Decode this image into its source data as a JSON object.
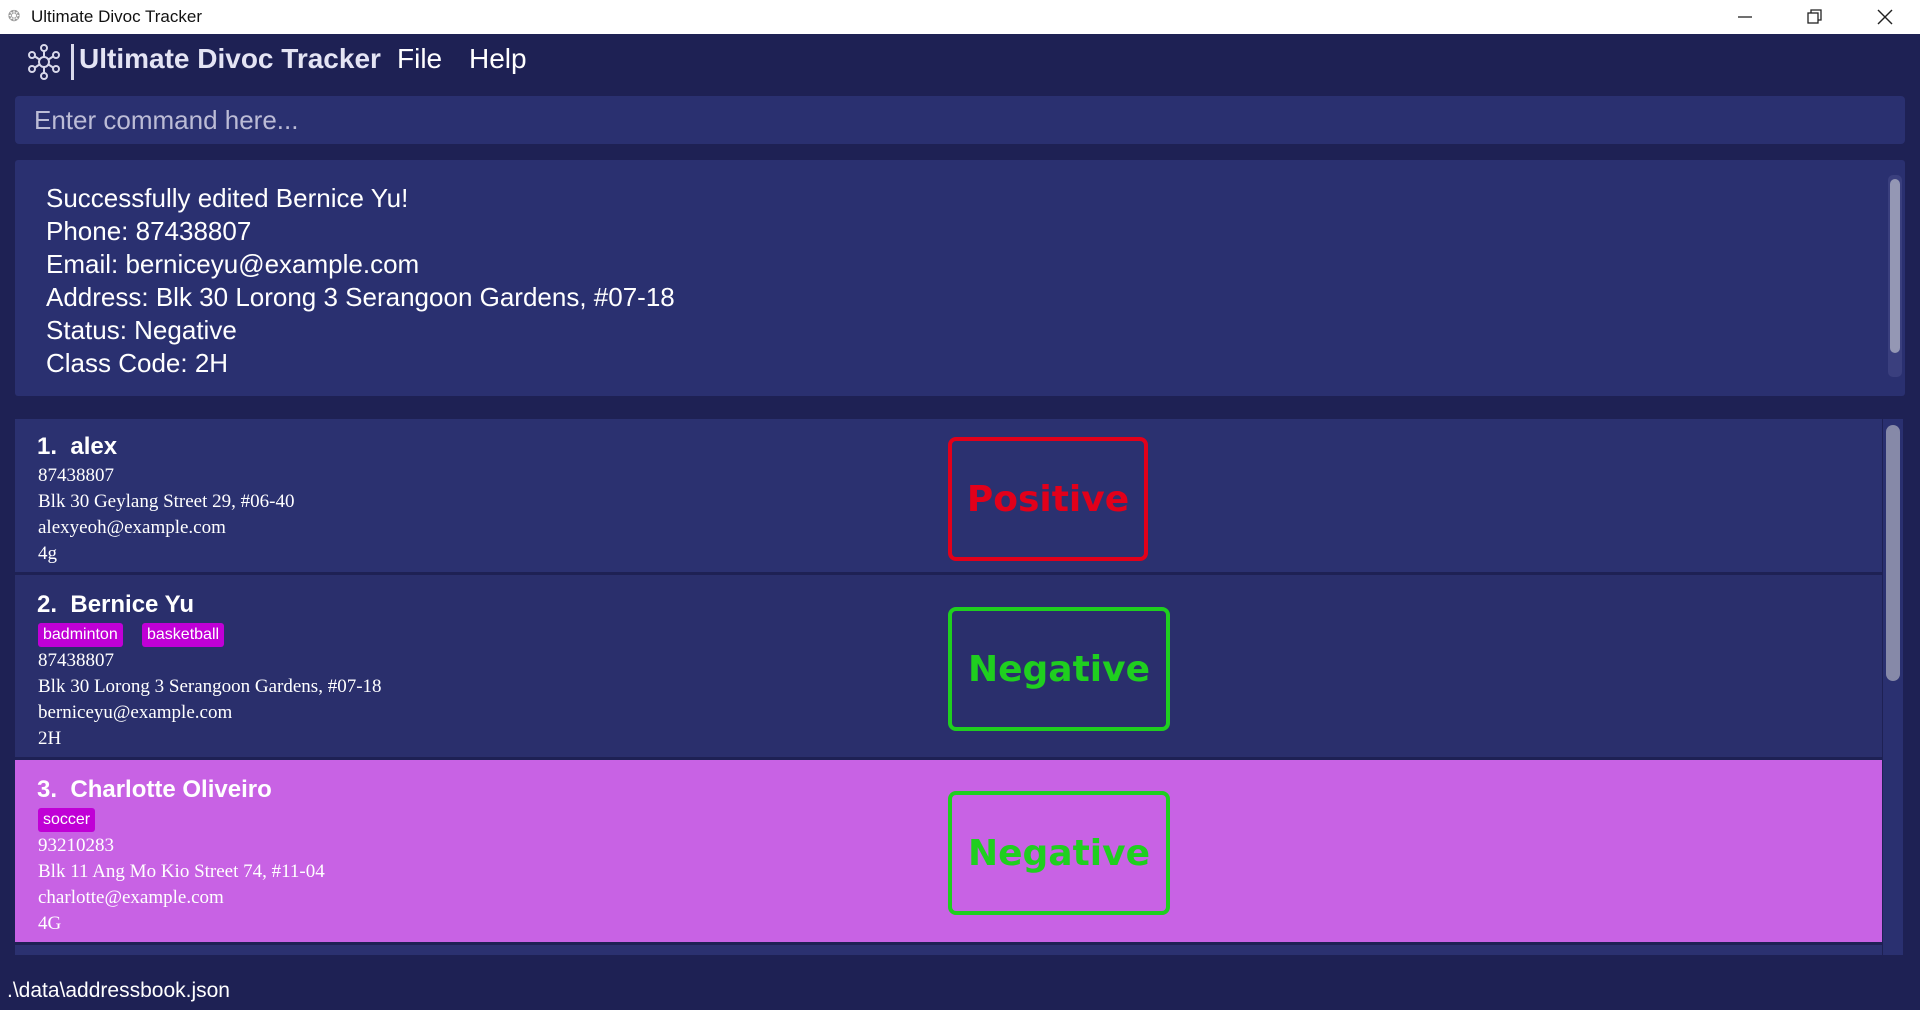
{
  "window": {
    "title": "Ultimate Divoc Tracker",
    "icon": "app-icon",
    "controls": [
      "minimize-icon",
      "restore-icon",
      "close-icon"
    ]
  },
  "menubar": {
    "brand": "Ultimate Divoc Tracker",
    "logo_icon": "gear-network-logo",
    "menus": [
      "File",
      "Help"
    ]
  },
  "command": {
    "placeholder": "Enter command here...",
    "value": ""
  },
  "result": {
    "text": "Successfully edited Bernice Yu!\nPhone: 87438807\nEmail: berniceyu@example.com\nAddress: Blk 30 Lorong 3 Serangoon Gardens, #07-18\nStatus: Negative\nClass Code: 2H"
  },
  "persons": [
    {
      "index": "1.",
      "name": "alex",
      "tags": [],
      "phone": "87438807",
      "address": "Blk 30 Geylang Street 29, #06-40",
      "email": "alexyeoh@example.com",
      "class_code": "4g",
      "status": "Positive",
      "status_color": "#e2001a",
      "selected": false
    },
    {
      "index": "2.",
      "name": "Bernice Yu",
      "tags": [
        "badminton",
        "basketball"
      ],
      "phone": "87438807",
      "address": "Blk 30 Lorong 3 Serangoon Gardens, #07-18",
      "email": "berniceyu@example.com",
      "class_code": "2H",
      "status": "Negative",
      "status_color": "#1fcf1f",
      "selected": false
    },
    {
      "index": "3.",
      "name": "Charlotte Oliveiro",
      "tags": [
        "soccer"
      ],
      "phone": "93210283",
      "address": "Blk 11 Ang Mo Kio Street 74, #11-04",
      "email": "charlotte@example.com",
      "class_code": "4G",
      "status": "Negative",
      "status_color": "#1fcf1f",
      "selected": true
    }
  ],
  "statusbar": {
    "path": ".\\data\\addressbook.json"
  },
  "colors": {
    "background": "#1e2154",
    "panel": "#2a3070",
    "selected": "#c862e4",
    "tag": "#c000d6"
  }
}
